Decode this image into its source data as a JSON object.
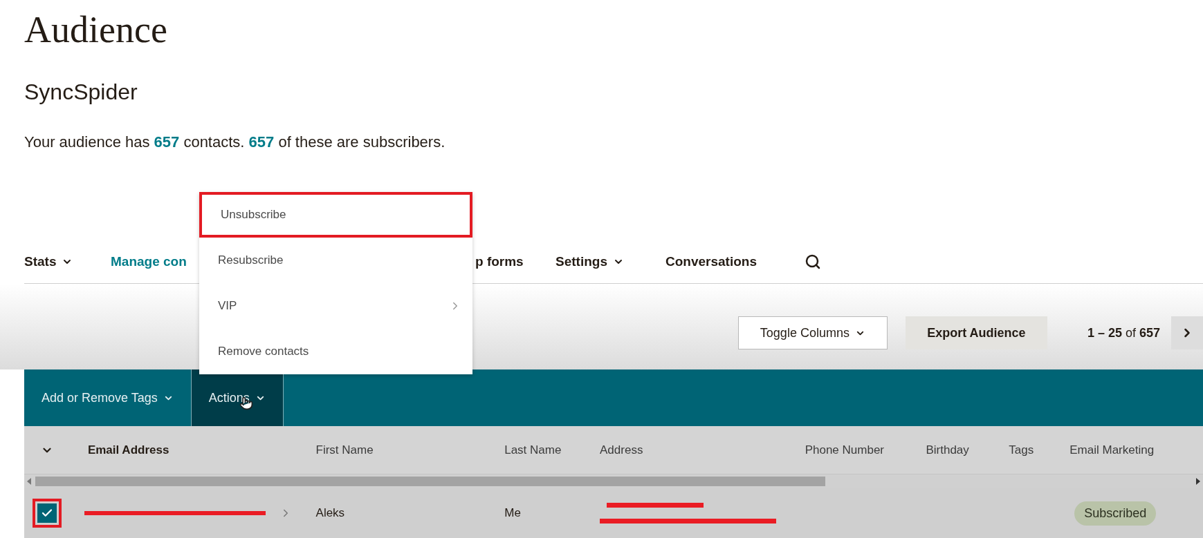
{
  "page": {
    "title": "Audience",
    "audience_name": "SyncSpider",
    "summary": "Your audience has **657** contacts. **657** of these are subscribers."
  },
  "nav": [
    {
      "label": "Stats",
      "dropdown": true,
      "selected": false
    },
    {
      "label": "Manage con",
      "dropdown": false,
      "selected": true
    },
    {
      "label": "p forms",
      "dropdown": false,
      "selected": false
    },
    {
      "label": "Settings",
      "dropdown": true,
      "selected": false
    },
    {
      "label": "Conversations",
      "dropdown": false,
      "selected": false
    }
  ],
  "actions_menu": [
    {
      "label": "Unsubscribe",
      "highlighted": true,
      "submenu": false
    },
    {
      "label": "Resubscribe",
      "highlighted": false,
      "submenu": false
    },
    {
      "label": "VIP",
      "highlighted": false,
      "submenu": true
    },
    {
      "label": "Remove contacts",
      "highlighted": false,
      "submenu": false
    }
  ],
  "toolbar": {
    "toggle_columns": "Toggle Columns",
    "export": "Export Audience",
    "pagination": "**1 – 25** of **657**"
  },
  "bulk_bar": [
    {
      "label": "Add or Remove Tags",
      "selected": false
    },
    {
      "label": "Actions",
      "selected": true
    }
  ],
  "table": {
    "columns": [
      "Email Address",
      "First Name",
      "Last Name",
      "Address",
      "Phone Number",
      "Birthday",
      "Tags",
      "Email Marketing"
    ],
    "rows": [
      {
        "checked": true,
        "highlighted": true,
        "email_redacted": true,
        "first_name": "Aleks",
        "last_name": "Me",
        "address_redacted": true,
        "status": "Subscribed"
      }
    ]
  }
}
